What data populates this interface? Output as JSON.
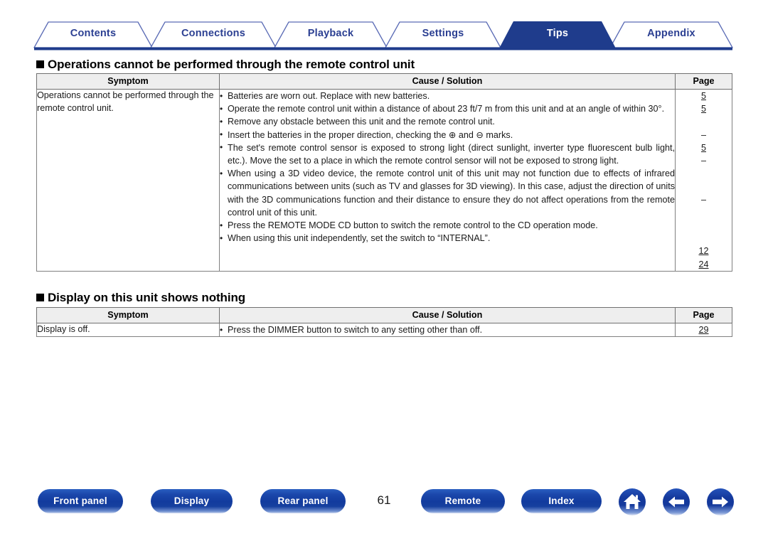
{
  "tabs": [
    {
      "label": "Contents",
      "active": false
    },
    {
      "label": "Connections",
      "active": false
    },
    {
      "label": "Playback",
      "active": false
    },
    {
      "label": "Settings",
      "active": false
    },
    {
      "label": "Tips",
      "active": true
    },
    {
      "label": "Appendix",
      "active": false
    }
  ],
  "sections": [
    {
      "heading": "Operations cannot be performed through the remote control unit",
      "columns": {
        "symptom": "Symptom",
        "cause": "Cause / Solution",
        "page": "Page"
      },
      "symptom": "Operations cannot be performed through the remote control unit.",
      "bullets": [
        "Batteries are worn out. Replace with new batteries.",
        "Operate the remote control unit within a distance of about 23 ft/7 m from this unit and at an angle of within 30°.",
        "Remove any obstacle between this unit and the remote control unit.",
        "Insert the batteries in the proper direction, checking the ⊕ and ⊖ marks.",
        "The set's remote control sensor is exposed to strong light (direct sunlight, inverter type fluorescent bulb light, etc.). Move the set to a place in which the remote control sensor will not be exposed to strong light.",
        "When using a 3D video device, the remote control unit of this unit may not function due to effects of infrared communications between units (such as TV and glasses for 3D viewing). In this case, adjust the direction of units with the 3D communications function and their distance to ensure they do not affect operations from the remote control unit of this unit.",
        "Press the REMOTE MODE CD button to switch the remote control to the CD operation mode.",
        "When using this unit independently, set the switch to “INTERNAL”."
      ],
      "pages": [
        "5",
        "5",
        "",
        "–",
        "5",
        "–",
        "",
        "",
        "–",
        "",
        "",
        "",
        "12",
        "24"
      ]
    },
    {
      "heading": "Display on this unit shows nothing",
      "columns": {
        "symptom": "Symptom",
        "cause": "Cause / Solution",
        "page": "Page"
      },
      "symptom": "Display is off.",
      "bullets": [
        "Press the DIMMER button to switch to any setting other than off."
      ],
      "pages": [
        "29"
      ]
    }
  ],
  "footer": {
    "buttons": [
      {
        "label": "Front panel"
      },
      {
        "label": "Display"
      },
      {
        "label": "Rear panel"
      },
      {
        "label": "Remote"
      },
      {
        "label": "Index"
      }
    ],
    "icons": [
      {
        "name": "home-icon"
      },
      {
        "name": "arrow-left-icon"
      },
      {
        "name": "arrow-right-icon"
      }
    ],
    "page_number": "61"
  },
  "colors": {
    "brand_blue": "#1f3c8c",
    "tab_text": "#2b3f92",
    "header_fill": "#eeeeee",
    "border": "#808080"
  }
}
